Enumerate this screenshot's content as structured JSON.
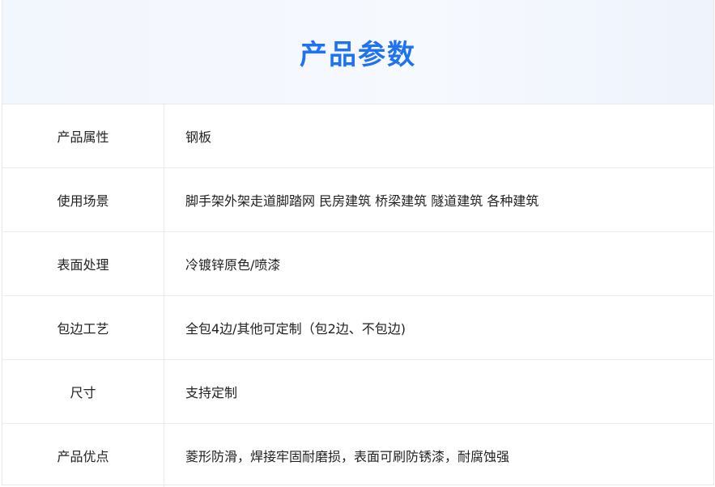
{
  "header": {
    "title": "产品参数"
  },
  "params": [
    {
      "label": "产品属性",
      "value": "钢板"
    },
    {
      "label": "使用场景",
      "value": "脚手架外架走道脚踏网 民房建筑 桥梁建筑 隧道建筑 各种建筑"
    },
    {
      "label": "表面处理",
      "value": "冷镀锌原色/喷漆"
    },
    {
      "label": "包边工艺",
      "value": "全包4边/其他可定制（包2边、不包边)"
    },
    {
      "label": "尺寸",
      "value": "支持定制"
    },
    {
      "label": "产品优点",
      "value": "菱形防滑，焊接牢固耐磨损，表面可刷防锈漆，耐腐蚀强"
    }
  ],
  "colors": {
    "title": "#1f73f0",
    "header_bg": "#f3f7fd",
    "border": "#e8ebf0"
  }
}
